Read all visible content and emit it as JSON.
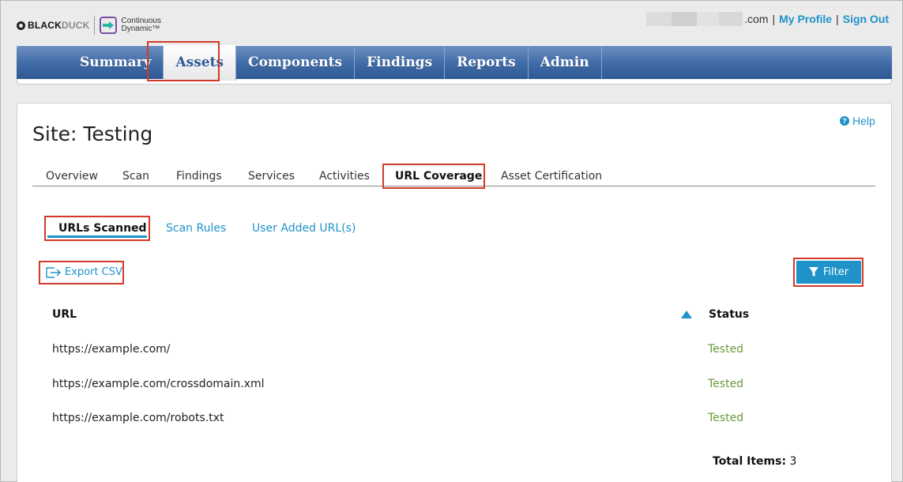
{
  "header": {
    "logo": {
      "brand_black": "BLACK",
      "brand_duck": "DUCK",
      "product_line1": "Continuous",
      "product_line2": "Dynamic™"
    },
    "user": {
      "domain_suffix": ".com",
      "separator": "|",
      "my_profile": "My Profile",
      "sign_out": "Sign Out"
    }
  },
  "nav": {
    "items": [
      {
        "label": "Summary"
      },
      {
        "label": "Assets"
      },
      {
        "label": "Components"
      },
      {
        "label": "Findings"
      },
      {
        "label": "Reports"
      },
      {
        "label": "Admin"
      }
    ],
    "active": "Assets"
  },
  "page": {
    "help": "Help",
    "title": "Site: Testing"
  },
  "tabs": {
    "items": [
      {
        "label": "Overview"
      },
      {
        "label": "Scan"
      },
      {
        "label": "Findings"
      },
      {
        "label": "Services"
      },
      {
        "label": "Activities"
      },
      {
        "label": "URL Coverage"
      },
      {
        "label": "Asset Certification"
      }
    ],
    "active": "URL Coverage"
  },
  "subtabs": {
    "items": [
      {
        "label": "URLs Scanned"
      },
      {
        "label": "Scan Rules"
      },
      {
        "label": "User Added URL(s)"
      }
    ],
    "active": "URLs Scanned"
  },
  "toolbar": {
    "export_csv": "Export CSV",
    "filter": "Filter"
  },
  "table": {
    "headers": {
      "url": "URL",
      "status": "Status"
    },
    "rows": [
      {
        "url": "https://example.com/",
        "status": "Tested"
      },
      {
        "url": "https://example.com/crossdomain.xml",
        "status": "Tested"
      },
      {
        "url": "https://example.com/robots.txt",
        "status": "Tested"
      }
    ],
    "total_label": "Total Items:",
    "total_value": "3"
  },
  "colors": {
    "accent": "#1f93c9",
    "nav_top": "#6e90c0",
    "nav_bottom": "#2f5993",
    "status_tested": "#6a9a3a",
    "highlight_box": "#d23a2b"
  }
}
